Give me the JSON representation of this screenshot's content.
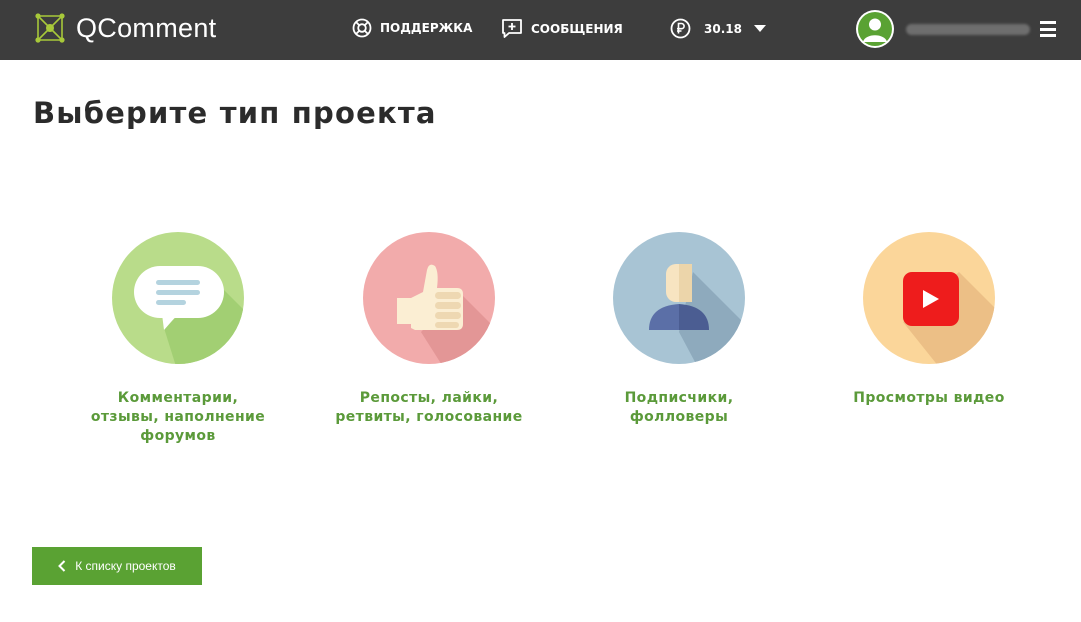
{
  "header": {
    "logo_text": "QComment",
    "nav": {
      "support_label": "ПОДДЕРЖКА",
      "messages_label": "СООБЩЕНИЯ",
      "balance_value": "30.18"
    },
    "icons": [
      "logo-icon",
      "lifebuoy-icon",
      "message-plus-icon",
      "ruble-icon",
      "chevron-down-icon",
      "avatar",
      "menu-icon"
    ]
  },
  "main": {
    "title": "Выберите тип проекта",
    "project_types": [
      {
        "label": "Комментарии,\nотзывы, наполнение\nфорумов",
        "icon": "comment-icon",
        "color": "#a8d46f"
      },
      {
        "label": "Репосты, лайки,\nретвиты, голосование",
        "icon": "thumbs-up-icon",
        "color": "#f0a3a3"
      },
      {
        "label": "Подписчики,\nфолловеры",
        "icon": "person-icon",
        "color": "#a6c2d2"
      },
      {
        "label": "Просмотры видео",
        "icon": "youtube-icon",
        "color": "#fbd596"
      }
    ]
  },
  "footer": {
    "back_label": "К списку проектов"
  },
  "colors": {
    "header_bg": "#3d3d3d",
    "accent_green": "#5aa233",
    "label_green": "#5b9a3a"
  }
}
